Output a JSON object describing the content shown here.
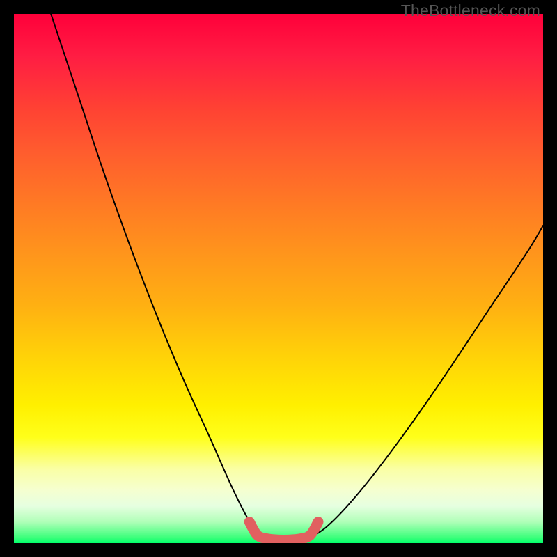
{
  "watermark": "TheBottleneck.com",
  "chart_data": {
    "type": "line",
    "title": "",
    "xlabel": "",
    "ylabel": "",
    "xlim": [
      0,
      100
    ],
    "ylim": [
      0,
      100
    ],
    "grid": false,
    "legend": false,
    "series": [
      {
        "name": "curve-left",
        "x": [
          7,
          12,
          17,
          22,
          27,
          32,
          37,
          41,
          44,
          46,
          47
        ],
        "y": [
          100,
          85,
          70,
          56,
          43,
          31,
          20,
          11,
          5,
          2,
          1
        ]
      },
      {
        "name": "valley-floor",
        "x": [
          47,
          50,
          53,
          56
        ],
        "y": [
          1,
          0.5,
          0.5,
          1
        ]
      },
      {
        "name": "curve-right",
        "x": [
          56,
          59,
          63,
          68,
          74,
          81,
          89,
          97,
          100
        ],
        "y": [
          1,
          3,
          7,
          13,
          21,
          31,
          43,
          55,
          60
        ]
      },
      {
        "name": "red-highlight",
        "x": [
          44.5,
          46,
          48,
          51,
          54,
          56,
          57.5
        ],
        "y": [
          4,
          1.5,
          0.8,
          0.6,
          0.8,
          1.5,
          4
        ]
      }
    ],
    "gradient_stops": [
      {
        "offset": 0,
        "color": "#ff003a"
      },
      {
        "offset": 8,
        "color": "#ff1d43"
      },
      {
        "offset": 18,
        "color": "#ff4233"
      },
      {
        "offset": 26,
        "color": "#ff5c2e"
      },
      {
        "offset": 36,
        "color": "#ff7a24"
      },
      {
        "offset": 45,
        "color": "#ff941c"
      },
      {
        "offset": 55,
        "color": "#ffb012"
      },
      {
        "offset": 65,
        "color": "#ffd308"
      },
      {
        "offset": 74,
        "color": "#fff000"
      },
      {
        "offset": 80,
        "color": "#ffff1a"
      },
      {
        "offset": 86,
        "color": "#faffa5"
      },
      {
        "offset": 90,
        "color": "#f5ffd0"
      },
      {
        "offset": 93,
        "color": "#e6ffe0"
      },
      {
        "offset": 96,
        "color": "#b0ffb8"
      },
      {
        "offset": 99,
        "color": "#3aff7a"
      },
      {
        "offset": 100,
        "color": "#00ff6a"
      }
    ],
    "highlight_color": "#e16060"
  }
}
